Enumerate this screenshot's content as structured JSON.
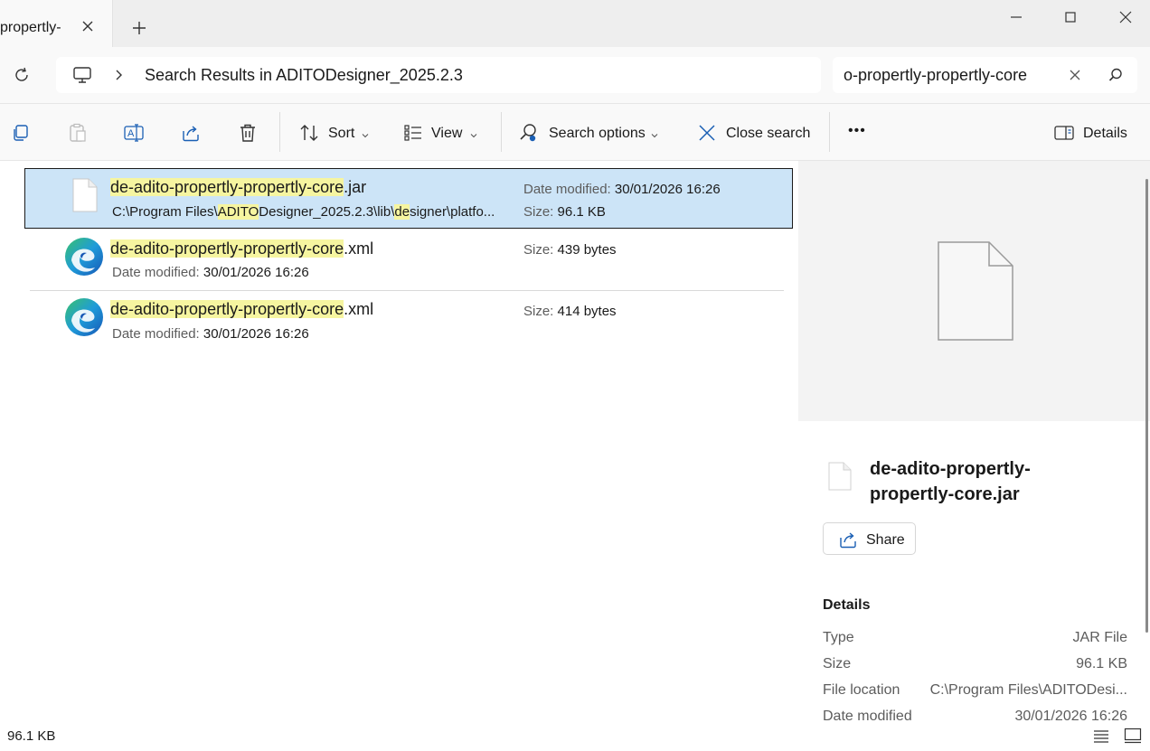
{
  "tab": {
    "title": "propertly-",
    "close": "×",
    "new": "+"
  },
  "window": {
    "minimize": "—",
    "close": "✕"
  },
  "address": {
    "path": "Search Results in ADITODesigner_2025.2.3",
    "search_value": "o-propertly-propertly-core"
  },
  "toolbar": {
    "sort": "Sort",
    "view": "View",
    "search_options": "Search options",
    "close_search": "Close search",
    "more": "•••",
    "details": "Details"
  },
  "results": [
    {
      "name_hl": "de-adito-propertly-propertly-core",
      "name_ext": ".jar",
      "path_parts": [
        "C:\\Program Files\\",
        "ADITO",
        "Designer_2025.2.3\\lib\\",
        "de",
        "signer\\platfo..."
      ],
      "date_label": "Date modified: ",
      "date_value": "30/01/2026 16:26",
      "size_label": "Size: ",
      "size_value": "96.1 KB"
    },
    {
      "name_hl": "de-adito-propertly-propertly-core",
      "name_ext": ".xml",
      "date_label": "Date modified: ",
      "date_value": "30/01/2026 16:26",
      "size_label": "Size: ",
      "size_value": "439 bytes"
    },
    {
      "name_hl": "de-adito-propertly-propertly-core",
      "name_ext": ".xml",
      "date_label": "Date modified: ",
      "date_value": "30/01/2026 16:26",
      "size_label": "Size: ",
      "size_value": "414 bytes"
    }
  ],
  "details_pane": {
    "title": "de-adito-propertly-propertly-core.jar",
    "share": "Share",
    "section": "Details",
    "rows": [
      {
        "key": "Type",
        "value": "JAR File"
      },
      {
        "key": "Size",
        "value": "96.1 KB"
      },
      {
        "key": "File location",
        "value": "C:\\Program Files\\ADITODesi..."
      },
      {
        "key": "Date modified",
        "value": "30/01/2026 16:26"
      }
    ]
  },
  "status": {
    "selection_size": "96.1 KB"
  },
  "colors": {
    "selection": "#cce4f7",
    "highlight": "#f6f5a0",
    "edge_blue": "#1b6fd1",
    "edge_green": "#39c26b"
  }
}
